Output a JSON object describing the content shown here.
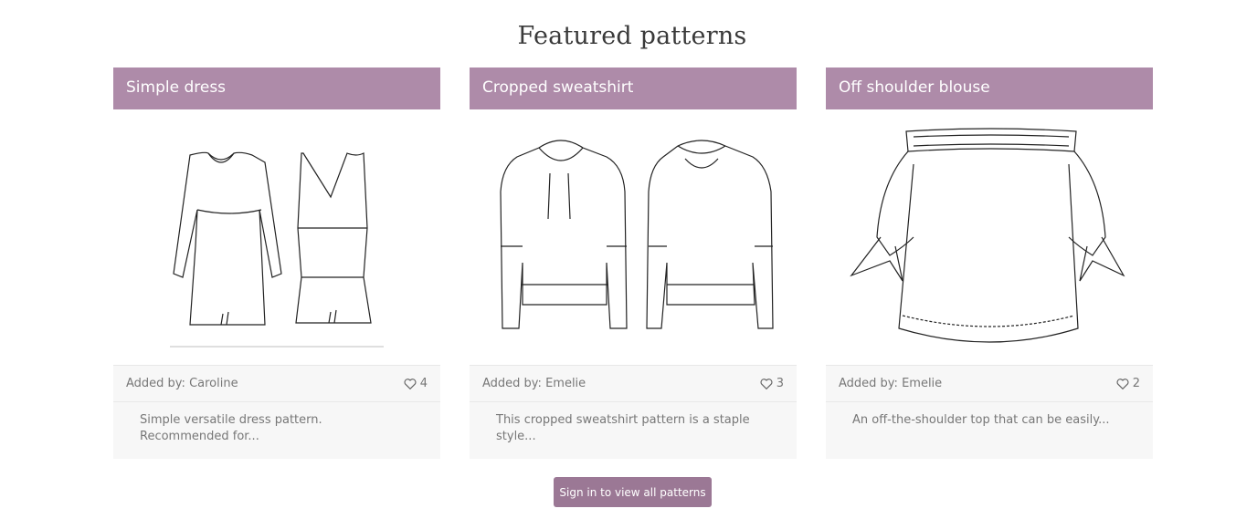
{
  "page": {
    "title": "Featured patterns"
  },
  "cards": [
    {
      "title": "Simple dress",
      "added_by": "Added by: Caroline",
      "likes": "4",
      "description": "Simple versatile dress pattern. Recommended for...",
      "image": "dress-drawing"
    },
    {
      "title": "Cropped sweatshirt",
      "added_by": "Added by: Emelie",
      "likes": "3",
      "description": "This cropped sweatshirt pattern is a staple style...",
      "image": "sweatshirt-drawing"
    },
    {
      "title": "Off shoulder blouse",
      "added_by": "Added by: Emelie",
      "likes": "2",
      "description": "An off-the-shoulder top that can be easily...",
      "image": "blouse-drawing"
    }
  ],
  "actions": {
    "sign_in_label": "Sign in to view all patterns"
  },
  "colors": {
    "header_bg": "#ae8ba9",
    "button_bg": "#9b7895",
    "card_bg": "#f7f7f7"
  },
  "icons": {
    "like": "heart-outline-icon"
  }
}
